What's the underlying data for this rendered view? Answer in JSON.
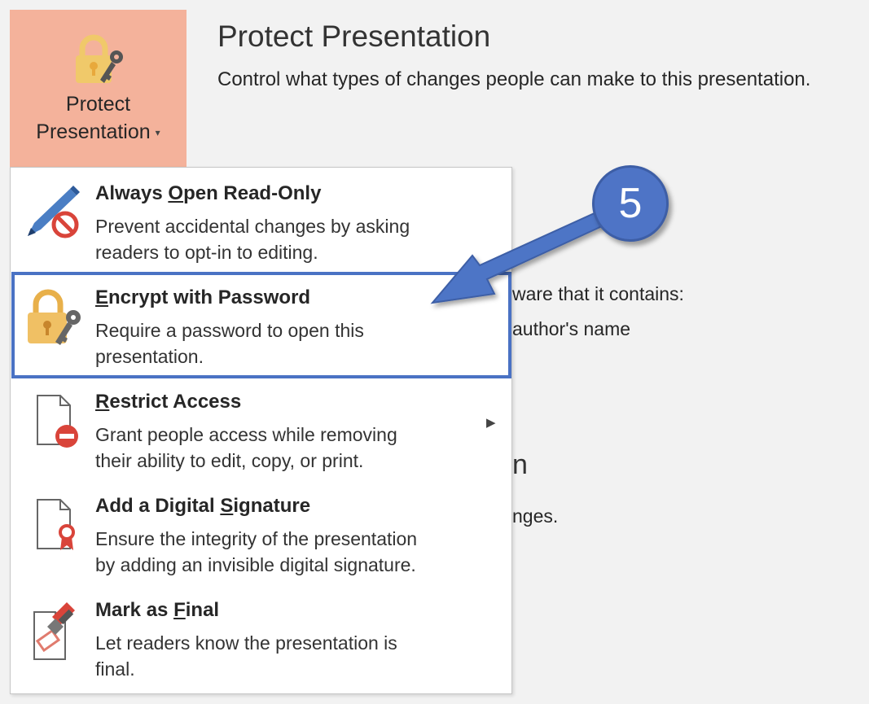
{
  "protect_button": {
    "label_line1": "Protect",
    "label_line2": "Presentation",
    "caret": "▾",
    "accent": "#f4b29b"
  },
  "header": {
    "title": "Protect Presentation",
    "subtitle": "Control what types of changes people can make to this presentation."
  },
  "background_fragments": {
    "line1": "ware that it contains:",
    "line2": "author's name",
    "heading": "n",
    "line3": "nges."
  },
  "menu": {
    "items": [
      {
        "title_pre": "Always ",
        "title_ul": "O",
        "title_post": "pen Read-Only",
        "desc": "Prevent accidental changes by asking\nreaders to opt-in to editing.",
        "icon": "pencil-no-icon"
      },
      {
        "title_pre": "",
        "title_ul": "E",
        "title_post": "ncrypt with Password",
        "desc": "Require a password to open this\npresentation.",
        "icon": "lock-key-icon"
      },
      {
        "title_pre": "",
        "title_ul": "R",
        "title_post": "estrict Access",
        "desc": "Grant people access while removing\ntheir ability to edit, copy, or print.",
        "icon": "document-restrict-icon",
        "submenu_arrow": "▶"
      },
      {
        "title_pre": "Add a Digital ",
        "title_ul": "S",
        "title_post": "ignature",
        "desc": "Ensure the integrity of the presentation\nby adding an invisible digital signature.",
        "icon": "document-ribbon-icon"
      },
      {
        "title_pre": "Mark as ",
        "title_ul": "F",
        "title_post": "inal",
        "desc": "Let readers know the presentation is\nfinal.",
        "icon": "stamp-icon"
      }
    ]
  },
  "callout": {
    "number": "5",
    "color": "#4e74c6"
  }
}
